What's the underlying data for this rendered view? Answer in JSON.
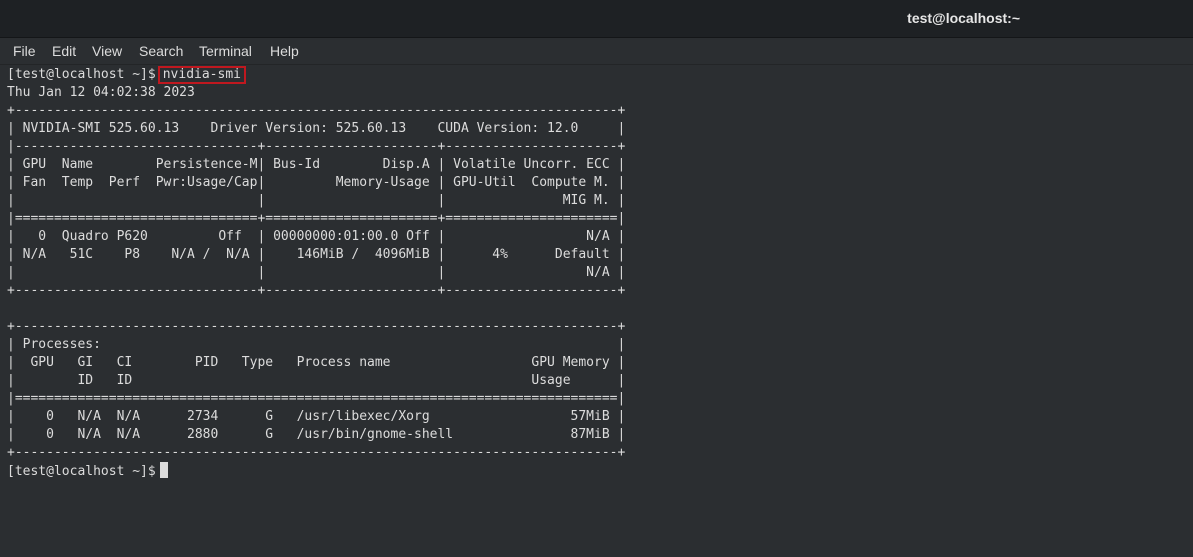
{
  "window": {
    "title": "test@localhost:~"
  },
  "menu": [
    "File",
    "Edit",
    "View",
    "Search",
    "Terminal",
    "Help"
  ],
  "terminal": {
    "prompt": "[test@localhost ~]$",
    "command": "nvidia-smi",
    "lines": [
      "Thu Jan 12 04:02:38 2023",
      "+-----------------------------------------------------------------------------+",
      "| NVIDIA-SMI 525.60.13    Driver Version: 525.60.13    CUDA Version: 12.0     |",
      "|-------------------------------+----------------------+----------------------+",
      "| GPU  Name        Persistence-M| Bus-Id        Disp.A | Volatile Uncorr. ECC |",
      "| Fan  Temp  Perf  Pwr:Usage/Cap|         Memory-Usage | GPU-Util  Compute M. |",
      "|                               |                      |               MIG M. |",
      "|===============================+======================+======================|",
      "|   0  Quadro P620         Off  | 00000000:01:00.0 Off |                  N/A |",
      "| N/A   51C    P8    N/A /  N/A |    146MiB /  4096MiB |      4%      Default |",
      "|                               |                      |                  N/A |",
      "+-------------------------------+----------------------+----------------------+",
      "",
      "+-----------------------------------------------------------------------------+",
      "| Processes:                                                                  |",
      "|  GPU   GI   CI        PID   Type   Process name                  GPU Memory |",
      "|        ID   ID                                                   Usage      |",
      "|=============================================================================|",
      "|    0   N/A  N/A      2734      G   /usr/libexec/Xorg                  57MiB |",
      "|    0   N/A  N/A      2880      G   /usr/bin/gnome-shell               87MiB |",
      "+-----------------------------------------------------------------------------+"
    ],
    "final_prompt": "[test@localhost ~]$"
  },
  "colors": {
    "background": "#2b2e31",
    "titlebar": "#1e2124",
    "text": "#dcdcdc",
    "highlight_box": "#c0181f"
  }
}
